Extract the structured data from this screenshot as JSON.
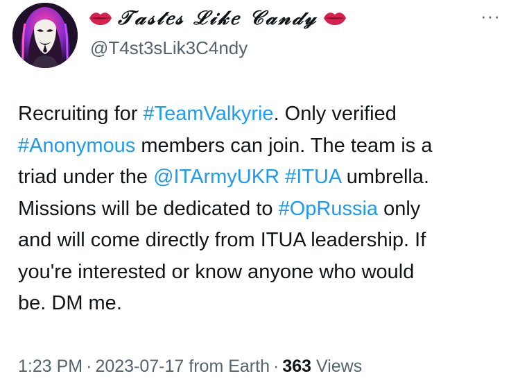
{
  "author": {
    "display_name": "𝒯𝒶𝓈𝓉𝑒𝓈 ℒ𝒾𝓀𝑒 𝒞𝒶𝓃𝒹𝓎",
    "handle": "@T4st3sLik3C4ndy",
    "avatar": "hooded-anonymous-mask-avatar",
    "name_decoration_icon": "lips-icon",
    "verified": false
  },
  "more_menu": {
    "icon": "ellipsis-icon",
    "label": "···"
  },
  "tweet": {
    "lines": [
      [
        {
          "t": "text",
          "v": "Recruiting for "
        },
        {
          "t": "tag",
          "v": "#TeamValkyrie"
        },
        {
          "t": "text",
          "v": ". Only verified"
        }
      ],
      [
        {
          "t": "tag",
          "v": "#Anonymous"
        },
        {
          "t": "text",
          "v": " members can join. The team is a"
        }
      ],
      [
        {
          "t": "text",
          "v": "triad under the "
        },
        {
          "t": "tag",
          "v": "@ITArmyUKR"
        },
        {
          "t": "text",
          "v": " "
        },
        {
          "t": "tag",
          "v": "#ITUA"
        },
        {
          "t": "text",
          "v": " umbrella."
        }
      ],
      [
        {
          "t": "text",
          "v": "Missions will be dedicated to "
        },
        {
          "t": "tag",
          "v": "#OpRussia"
        },
        {
          "t": "text",
          "v": " only"
        }
      ],
      [
        {
          "t": "text",
          "v": "and will come directly from ITUA leadership. If"
        }
      ],
      [
        {
          "t": "text",
          "v": "you're interested or know anyone who would"
        }
      ],
      [
        {
          "t": "text",
          "v": "be. DM me."
        }
      ]
    ]
  },
  "meta": {
    "time": "1:23 PM",
    "date": "2023-07-17",
    "source": "from Earth",
    "views_count": "363",
    "views_label": "Views",
    "separator": "·"
  },
  "colors": {
    "link": "#1d9bf0",
    "text": "#0f1419",
    "secondary": "#536471",
    "lips": "#d6204e"
  }
}
